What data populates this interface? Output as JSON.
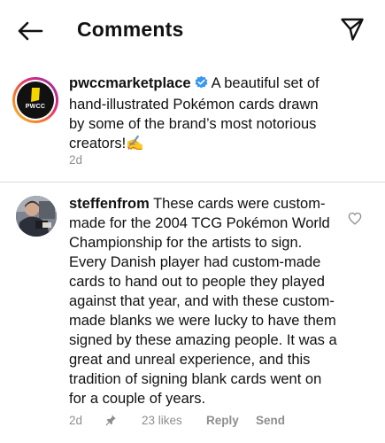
{
  "header": {
    "title": "Comments",
    "back_icon": "arrow-left-icon",
    "send_icon": "paper-plane-icon"
  },
  "caption": {
    "username": "pwccmarketplace",
    "verified": true,
    "text": "A beautiful set of hand-illustrated Pokémon cards drawn by some of the brand’s most notorious creators!✍️",
    "time": "2d",
    "avatar_label": "PWCC"
  },
  "comments": [
    {
      "username": "steffenfrom",
      "text": "These cards were custom-made for the 2004 TCG Pokémon World Championship for the artists to sign. Every Danish player had custom-made cards to hand out to people they played against that year, and with these custom-made blanks we were lucky to have them signed by these amazing people. It was a great and unreal experience, and this tradition of signing blank cards went on for a couple of years.",
      "time": "2d",
      "pinned": true,
      "likes": "23 likes",
      "reply_label": "Reply",
      "send_label": "Send"
    }
  ],
  "colors": {
    "text": "#111111",
    "secondary": "#8e8e8e",
    "verified": "#3897f0",
    "divider": "#dbdbdb",
    "logo_yellow": "#f5d400"
  }
}
